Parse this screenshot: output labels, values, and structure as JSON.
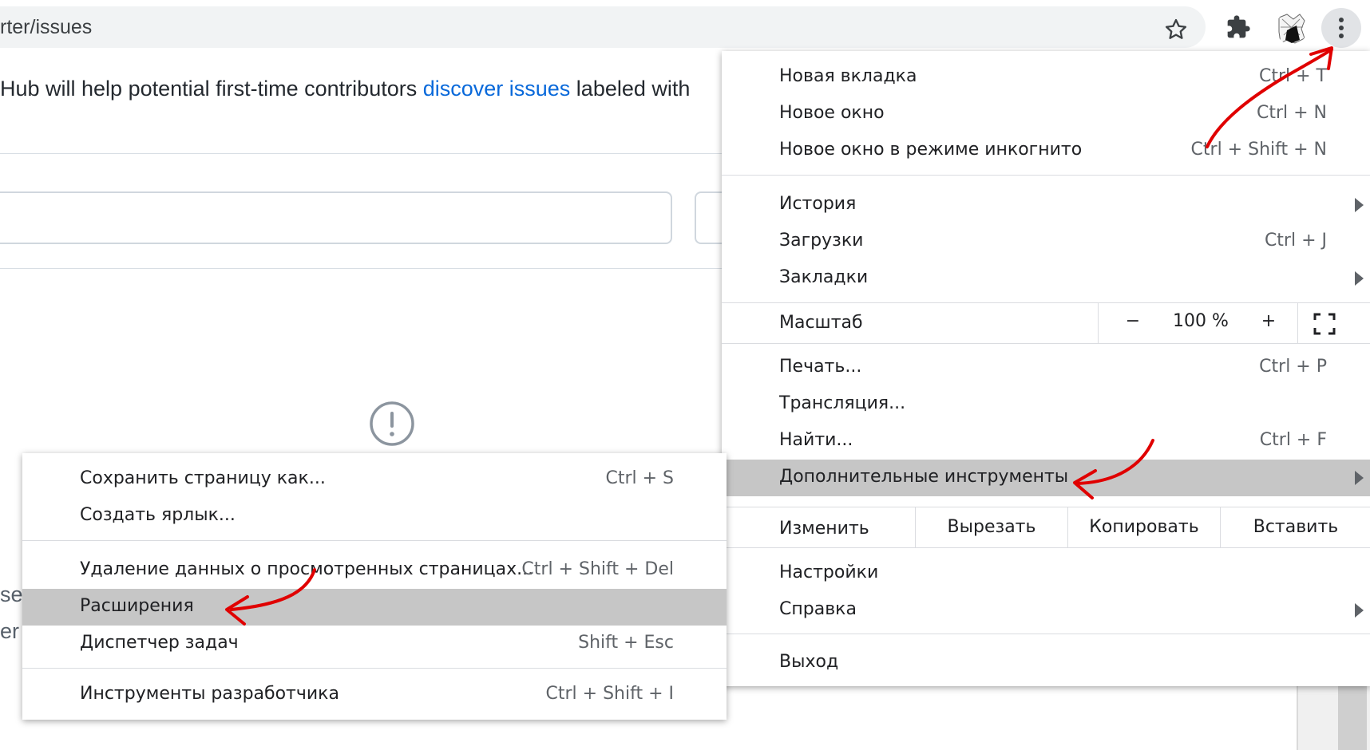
{
  "browser": {
    "url_text": "rter/issues",
    "icons": [
      "star-icon",
      "extensions-puzzle-icon",
      "profile-avatar",
      "more-vert-icon"
    ]
  },
  "page": {
    "intro_before": "Hub will help potential first-time contributors ",
    "intro_link": "discover issues",
    "intro_after": " labeled with ",
    "partial_1": "se",
    "partial_2": "er"
  },
  "main_menu": {
    "new_tab": {
      "label": "Новая вкладка",
      "shortcut": "Ctrl + T"
    },
    "new_window": {
      "label": "Новое окно",
      "shortcut": "Ctrl + N"
    },
    "incognito": {
      "label": "Новое окно в режиме инкогнито",
      "shortcut": "Ctrl + Shift + N"
    },
    "history": {
      "label": "История"
    },
    "downloads": {
      "label": "Загрузки",
      "shortcut": "Ctrl + J"
    },
    "bookmarks": {
      "label": "Закладки"
    },
    "zoom": {
      "label": "Масштаб",
      "minus": "−",
      "value": "100 %",
      "plus": "+"
    },
    "print": {
      "label": "Печать...",
      "shortcut": "Ctrl + P"
    },
    "cast": {
      "label": "Трансляция..."
    },
    "find": {
      "label": "Найти...",
      "shortcut": "Ctrl + F"
    },
    "more_tools": {
      "label": "Дополнительные инструменты"
    },
    "edit": {
      "label": "Изменить",
      "cut": "Вырезать",
      "copy": "Копировать",
      "paste": "Вставить"
    },
    "settings": {
      "label": "Настройки"
    },
    "help": {
      "label": "Справка"
    },
    "exit": {
      "label": "Выход"
    }
  },
  "sub_menu": {
    "save_page": {
      "label": "Сохранить страницу как...",
      "shortcut": "Ctrl + S"
    },
    "create_shortcut": {
      "label": "Создать ярлык..."
    },
    "clear_data": {
      "label": "Удаление данных о просмотренных страницах...",
      "shortcut": "Ctrl + Shift + Del"
    },
    "extensions": {
      "label": "Расширения"
    },
    "task_manager": {
      "label": "Диспетчер задач",
      "shortcut": "Shift + Esc"
    },
    "dev_tools": {
      "label": "Инструменты разработчика",
      "shortcut": "Ctrl + Shift + I"
    }
  },
  "colors": {
    "highlight": "#c6c6c6",
    "link": "#0969da",
    "annotation": "#e00000"
  }
}
